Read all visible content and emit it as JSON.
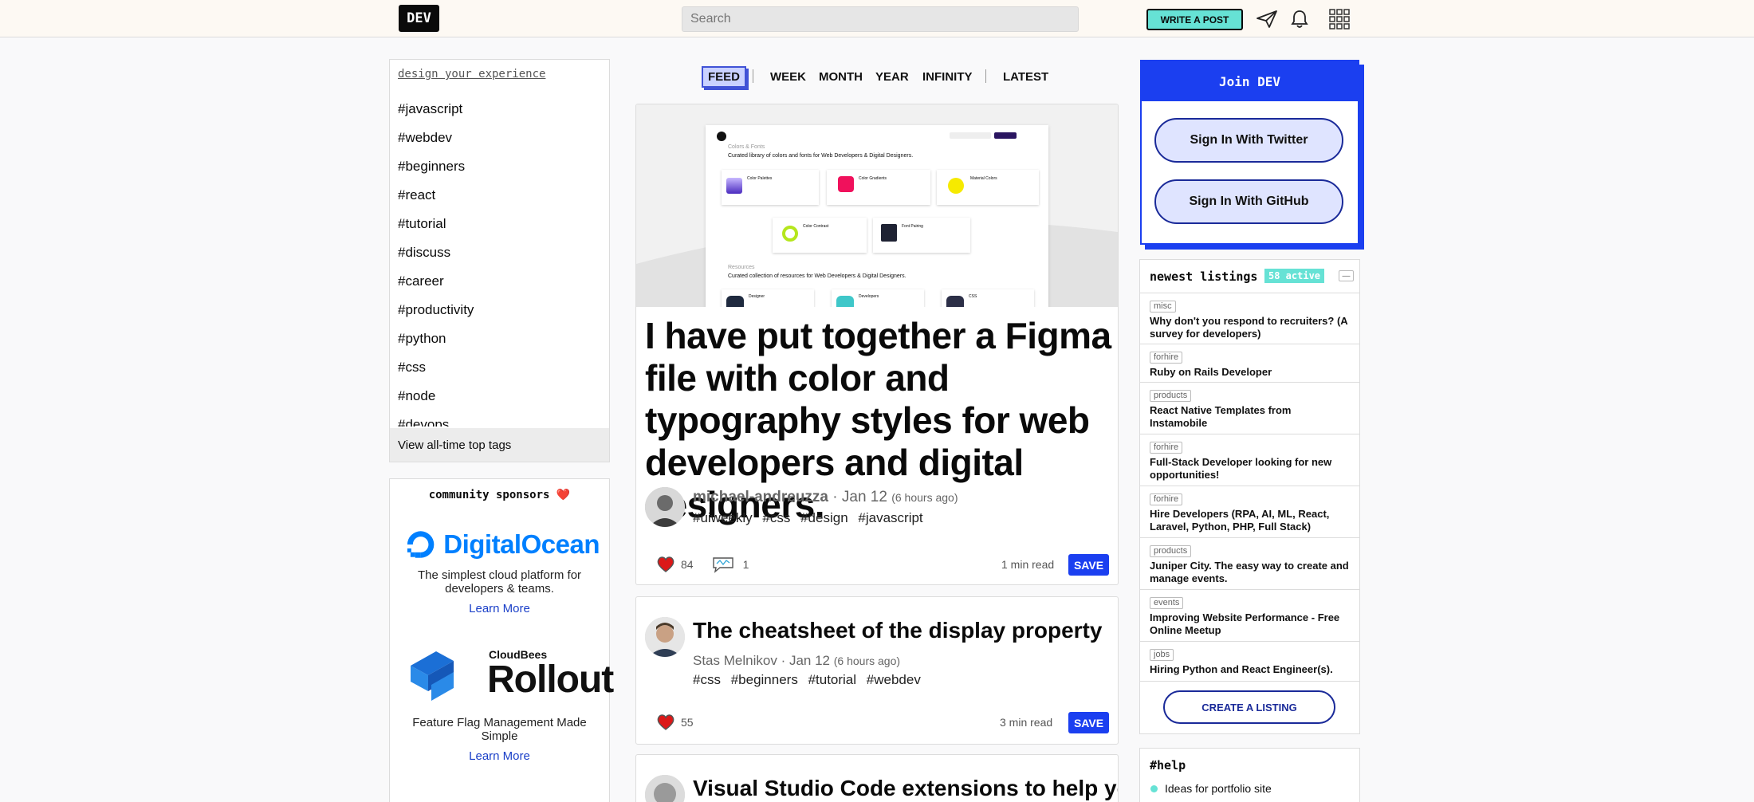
{
  "header": {
    "logo": "DEV",
    "search_placeholder": "Search",
    "write_post": "WRITE A POST",
    "icons": [
      "paper-plane-icon",
      "bell-icon",
      "apps-grid-icon"
    ]
  },
  "sidebar_left": {
    "heading": "design your experience",
    "tags": [
      "#javascript",
      "#webdev",
      "#beginners",
      "#react",
      "#tutorial",
      "#discuss",
      "#career",
      "#productivity",
      "#python",
      "#css",
      "#node",
      "#devops"
    ],
    "footer_link": "View all-time top tags"
  },
  "sponsors": {
    "title": "community sponsors",
    "heart": "❤️",
    "digitalocean": {
      "name": "DigitalOcean",
      "desc": "The simplest cloud platform for developers & teams.",
      "link": "Learn More"
    },
    "rollout": {
      "brand_small": "CloudBees",
      "name": "Rollout",
      "desc": "Feature Flag Management Made Simple",
      "link": "Learn More"
    }
  },
  "feed_tabs": [
    "FEED",
    "WEEK",
    "MONTH",
    "YEAR",
    "INFINITY",
    "LATEST"
  ],
  "feed_active": "FEED",
  "articles": [
    {
      "title": "I have put together a Figma file with color and typography styles for web developers and digital designers.",
      "author": "michael-andreuzza",
      "date": "Jan 12",
      "ago": "(6 hours ago)",
      "tags": [
        "#uiweekly",
        "#css",
        "#design",
        "#javascript"
      ],
      "reactions": "84",
      "comments": "1",
      "read_time": "1 min read",
      "save": "SAVE",
      "hero": {
        "section1_title": "Colors & Fonts",
        "section1_sub": "Curated library of colors and fonts for Web Developers & Digital Designers.",
        "cards1": [
          "Color Palettes",
          "Color Gradients",
          "Material Colors"
        ],
        "cards2": [
          "Color Contrast",
          "Font Pairing"
        ],
        "section2_title": "Resources",
        "section2_sub": "Curated collection of resources for Web Developers & Digital Designers.",
        "cards3": [
          "Designer",
          "Developers",
          "CSS"
        ]
      }
    },
    {
      "title": "The cheatsheet of the display property",
      "author": "Stas Melnikov",
      "date": "Jan 12",
      "ago": "(6 hours ago)",
      "tags": [
        "#css",
        "#beginners",
        "#tutorial",
        "#webdev"
      ],
      "reactions": "55",
      "read_time": "3 min read",
      "save": "SAVE"
    },
    {
      "title": "Visual Studio Code extensions to help your"
    }
  ],
  "join": {
    "title": "Join DEV",
    "twitter": "Sign In With Twitter",
    "github": "Sign In With GitHub"
  },
  "listings": {
    "title": "newest listings",
    "active": "58 active",
    "collapse": "—",
    "items": [
      {
        "cat": "misc",
        "title": "Why don't you respond to recruiters? (A survey for developers)"
      },
      {
        "cat": "forhire",
        "title": "Ruby on Rails Developer"
      },
      {
        "cat": "products",
        "title": "React Native Templates from Instamobile"
      },
      {
        "cat": "forhire",
        "title": "Full-Stack Developer looking for new opportunities!"
      },
      {
        "cat": "forhire",
        "title": "Hire Developers (RPA, AI, ML, React, Laravel, Python, PHP, Full Stack)"
      },
      {
        "cat": "products",
        "title": "Juniper City. The easy way to create and manage events."
      },
      {
        "cat": "events",
        "title": "Improving Website Performance - Free Online Meetup"
      },
      {
        "cat": "jobs",
        "title": "Hiring Python and React Engineer(s)."
      }
    ],
    "create": "CREATE A LISTING"
  },
  "help": {
    "title": "#help",
    "item": "Ideas for portfolio site"
  },
  "colors": {
    "accent_blue": "#1b3ff0",
    "teal": "#66e2d5",
    "heart": "#dc1818"
  }
}
